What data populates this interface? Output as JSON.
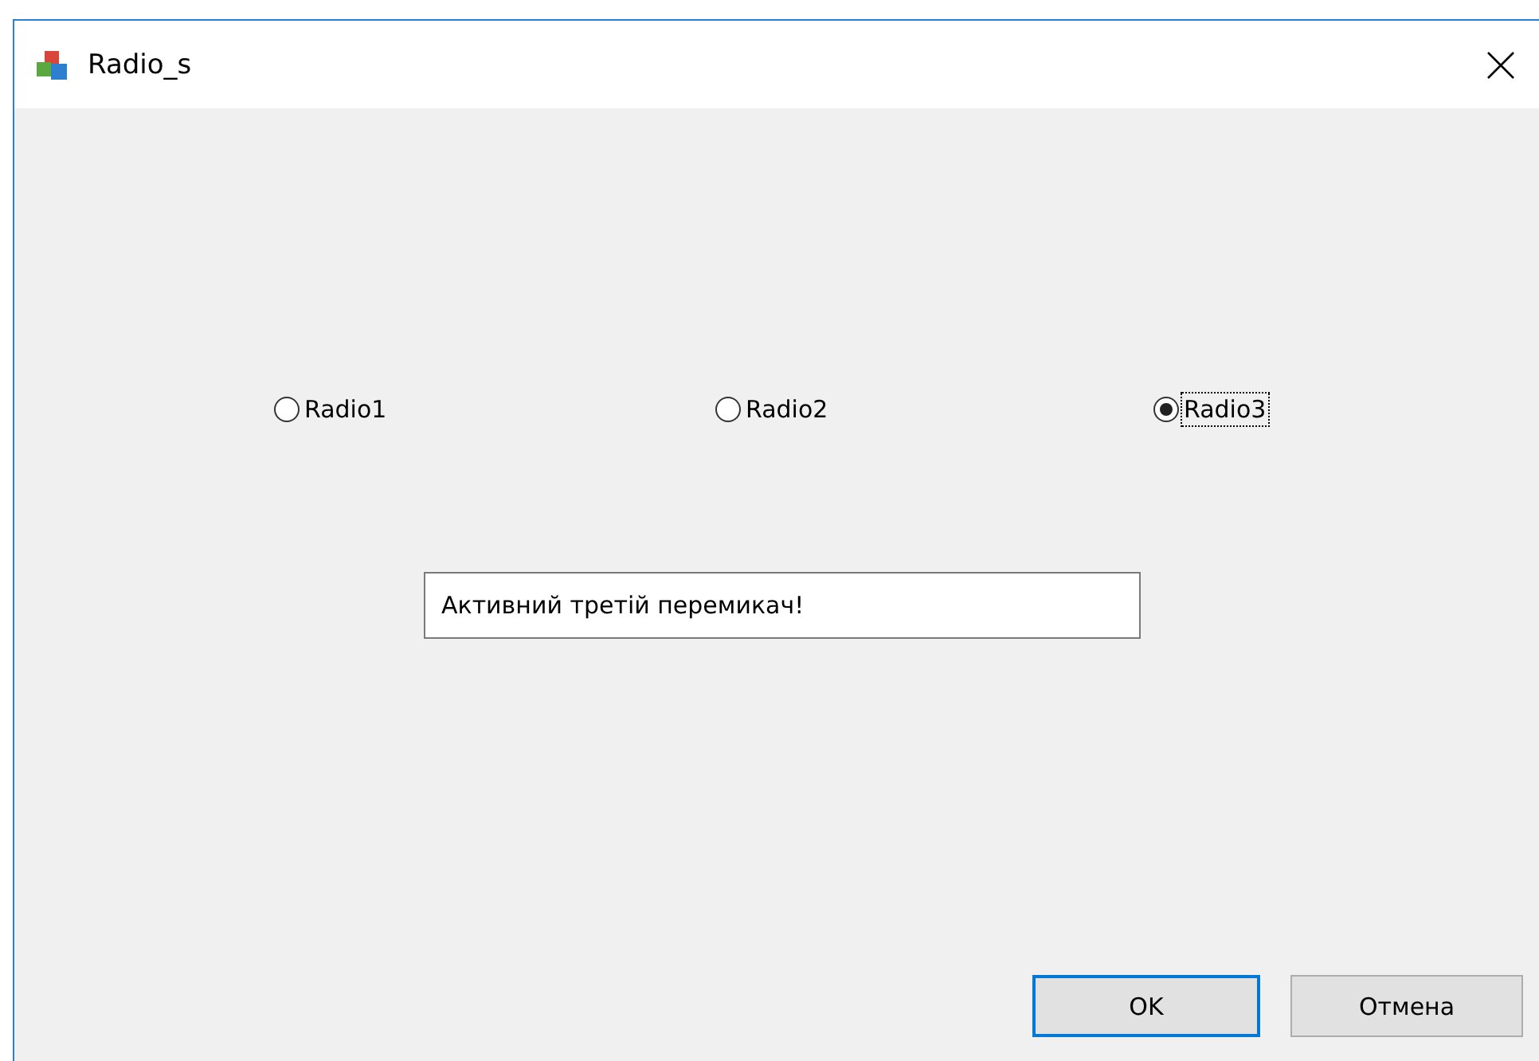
{
  "window": {
    "title": "Radio_s"
  },
  "radios": [
    {
      "label": "Radio1",
      "selected": false,
      "focused": false
    },
    {
      "label": "Radio2",
      "selected": false,
      "focused": false
    },
    {
      "label": "Radio3",
      "selected": true,
      "focused": true
    }
  ],
  "message_field": {
    "value": "Активний третій перемикач!"
  },
  "buttons": [
    {
      "label": "OK",
      "default": true
    },
    {
      "label": "Отмена",
      "default": false
    }
  ]
}
